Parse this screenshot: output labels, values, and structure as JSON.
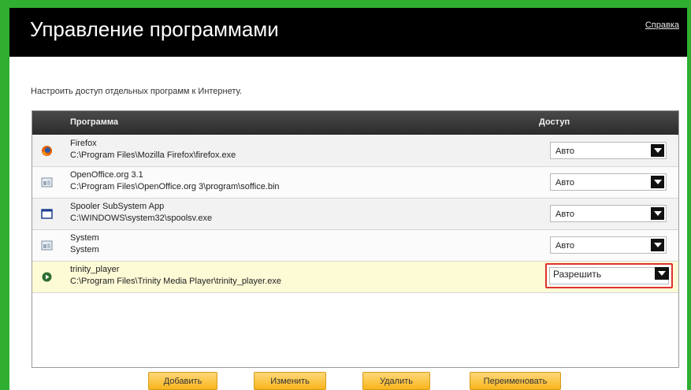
{
  "header": {
    "title": "Управление программами",
    "help_link": "Справка"
  },
  "description": "Настроить доступ отдельных программ к Интернету.",
  "table": {
    "columns": [
      "Программа",
      "Доступ"
    ],
    "rows": [
      {
        "icon": "firefox-icon",
        "name": "Firefox",
        "path": "C:\\Program Files\\Mozilla Firefox\\firefox.exe",
        "access": "Авто"
      },
      {
        "icon": "app-window-icon",
        "name": "OpenOffice.org 3.1",
        "path": "C:\\Program Files\\OpenOffice.org 3\\program\\soffice.bin",
        "access": "Авто"
      },
      {
        "icon": "window-icon",
        "name": "Spooler SubSystem App",
        "path": "C:\\WINDOWS\\system32\\spoolsv.exe",
        "access": "Авто"
      },
      {
        "icon": "app-window-icon",
        "name": "System",
        "path": "System",
        "access": "Авто"
      },
      {
        "icon": "play-icon",
        "name": "trinity_player",
        "path": "C:\\Program Files\\Trinity Media Player\\trinity_player.exe",
        "access": "Разрешить"
      }
    ]
  },
  "buttons": {
    "add": "Добавить",
    "edit": "Изменить",
    "delete": "Удалить",
    "rename": "Переименовать"
  },
  "colors": {
    "highlight_row": "#fdfbd6",
    "focus_border": "#e0322a",
    "button": "#f8b51c"
  }
}
